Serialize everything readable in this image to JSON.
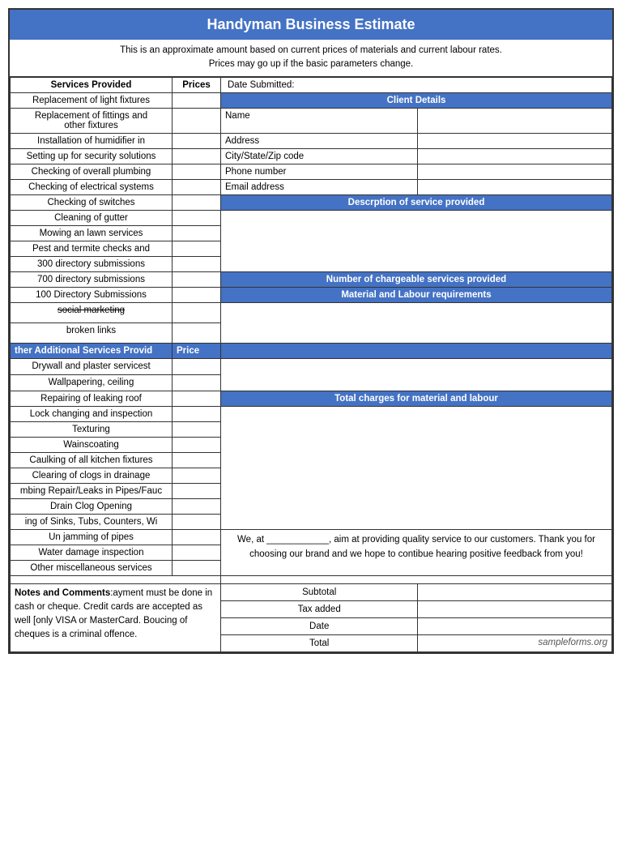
{
  "title": "Handyman Business Estimate",
  "disclaimer": {
    "line1": "This is an approximate amount based on current prices of materials and current labour rates.",
    "line2": "Prices may go up if the basic parameters change."
  },
  "table": {
    "header": {
      "col1": "Services Provided",
      "col2": "Prices",
      "col3": "Date Submitted:"
    },
    "client_details_header": "Client Details",
    "client_fields": [
      {
        "label": "Name",
        "value": ""
      },
      {
        "label": "Address",
        "value": ""
      },
      {
        "label": "City/State/Zip code",
        "value": ""
      },
      {
        "label": "Phone number",
        "value": ""
      },
      {
        "label": "Email address",
        "value": ""
      }
    ],
    "description_header": "Descrption of service provided",
    "number_chargeable_header": "Number of chargeable services provided",
    "material_labour_header": "Material and Labour requirements",
    "total_charges_header": "Total charges for material and labour",
    "services": [
      "Replacement of light fixtures",
      "Replacement of fittings and other fixtures",
      "Installation of humidifier in",
      "Setting up for security solutions",
      "Checking of overall plumbing",
      "Checking of electrical systems",
      "Checking of switches",
      "Cleaning of gutter",
      "Mowing an lawn services",
      "Pest and termite checks and",
      "300 directory submissions",
      "700 directory submissions",
      "100 Directory Submissions",
      "social marketing",
      "broken links"
    ],
    "additional_header": "ther Additional Services Provid",
    "price_header": "Price",
    "additional_services": [
      "Drywall and plaster servicest",
      "Wallpapering, ceiling",
      "Repairing of leaking roof",
      "Lock changing and inspection",
      "Texturing",
      "Wainscoating",
      "Caulking of all kitchen fixtures",
      "Clearing of clogs in drainage",
      "mbing Repair/Leaks in Pipes/Fauc",
      "Drain Clog Opening",
      "ing of Sinks, Tubs, Counters, Wi",
      "Un jamming of pipes",
      "Water damage inspection",
      "Other miscellaneous services"
    ],
    "thank_you_text": {
      "line1": "We, at ____________, aim at providing quality service to our customers. Thank you for choosing our brand and we hope to contibue hearing positive feedback from you!"
    },
    "notes_label": "Notes and Comments",
    "notes_text": ":ayment must be done in cash or cheque. Credit cards are accepted as well [only VISA or MasterCard. Boucing of cheques is a criminal offence.",
    "subtotal_label": "Subtotal",
    "tax_label": "Tax added",
    "date_label": "Date",
    "total_label": "Total",
    "sampleforms": "sampleforms.org"
  }
}
